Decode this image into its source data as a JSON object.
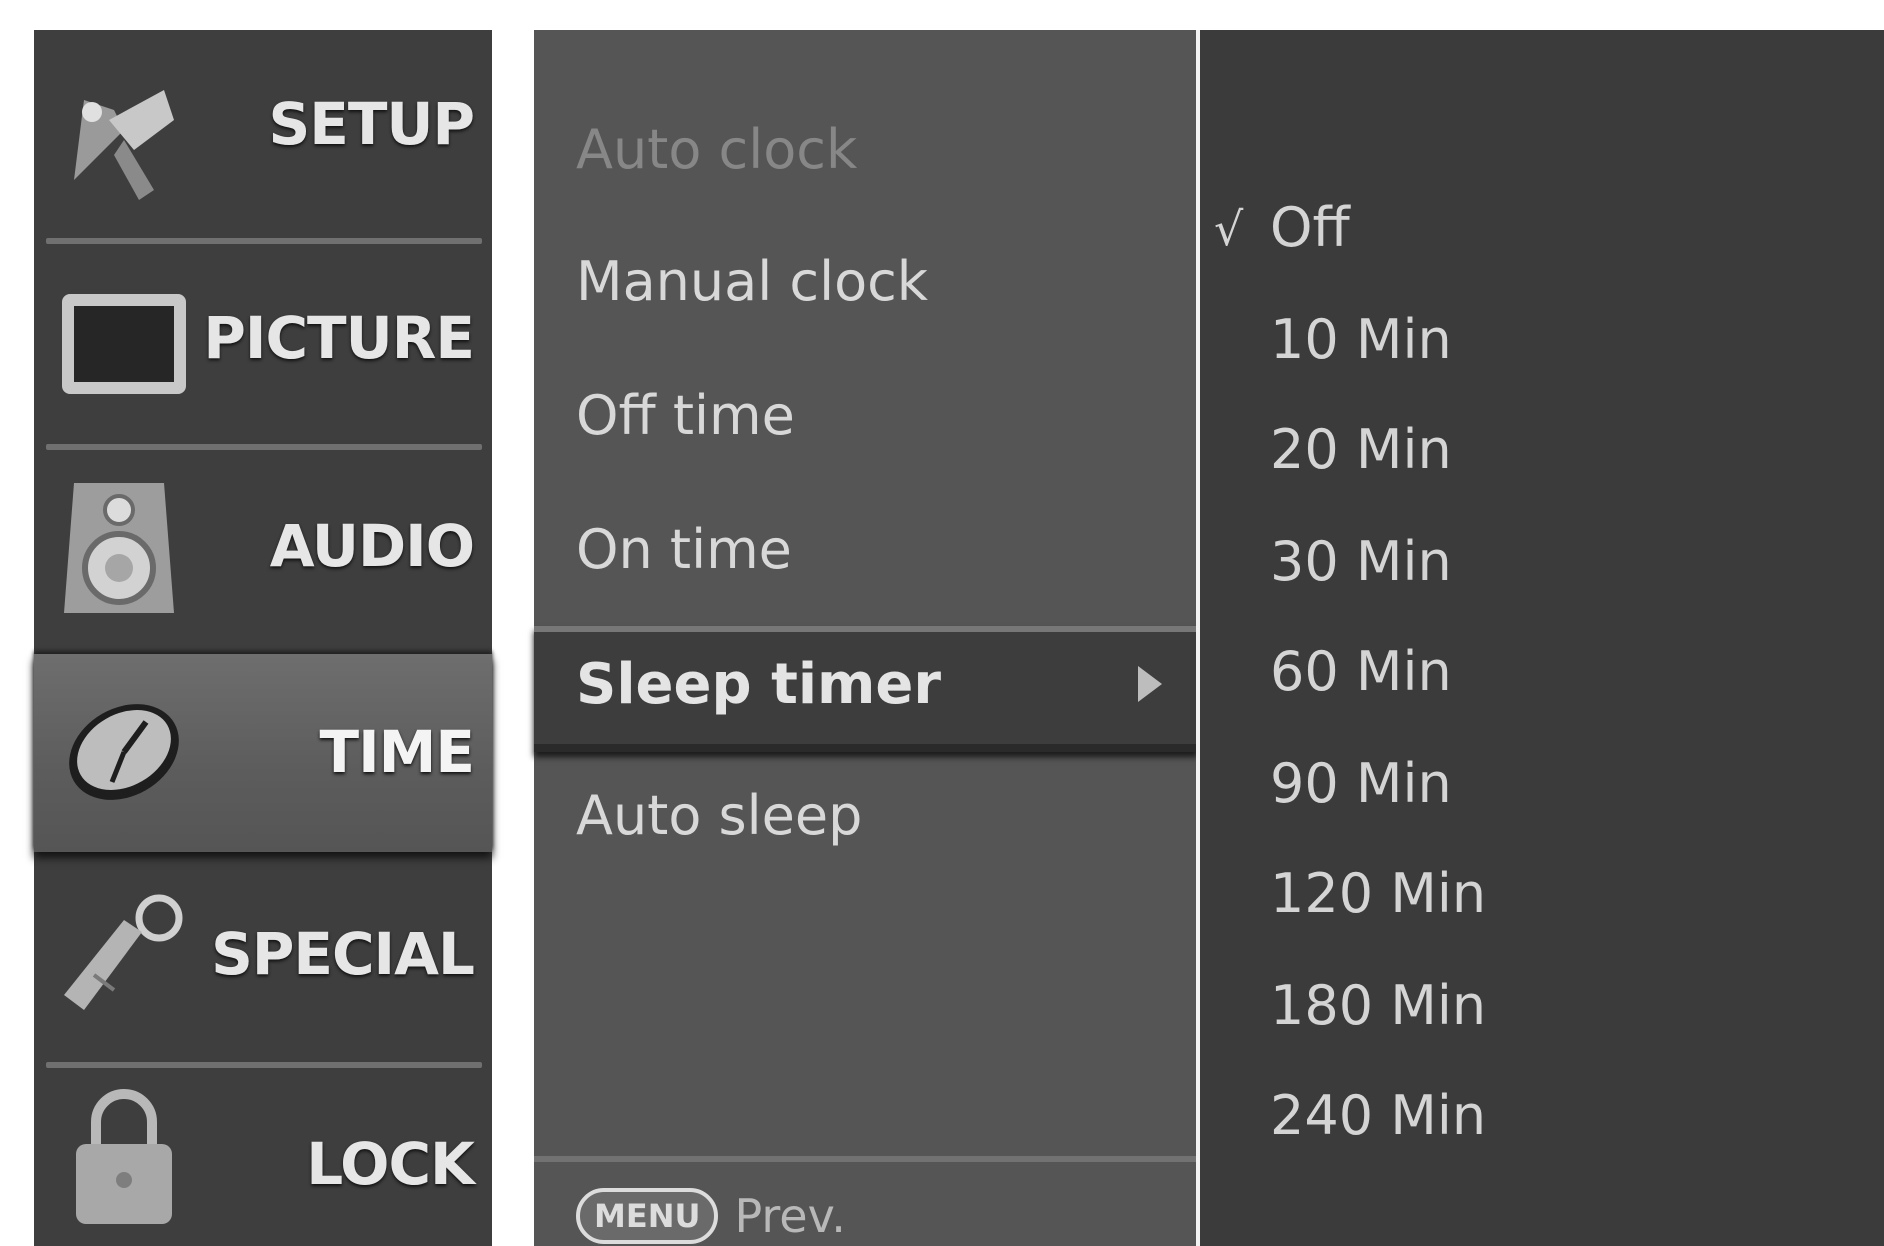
{
  "categories": [
    {
      "label": "SETUP",
      "icon": "satellite-icon",
      "active": false
    },
    {
      "label": "PICTURE",
      "icon": "tv-screen-icon",
      "active": false
    },
    {
      "label": "AUDIO",
      "icon": "speaker-icon",
      "active": false
    },
    {
      "label": "TIME",
      "icon": "clock-icon",
      "active": true
    },
    {
      "label": "SPECIAL",
      "icon": "tag-key-icon",
      "active": false
    },
    {
      "label": "LOCK",
      "icon": "padlock-icon",
      "active": false
    }
  ],
  "options": [
    {
      "label": "Auto clock",
      "disabled": true
    },
    {
      "label": "Manual clock",
      "disabled": false
    },
    {
      "label": "Off time",
      "disabled": false
    },
    {
      "label": "On time",
      "disabled": false
    },
    {
      "label": "Sleep timer",
      "selected": true
    },
    {
      "label": "Auto sleep",
      "disabled": false
    }
  ],
  "footer": {
    "key_label": "MENU",
    "text": "Prev."
  },
  "values": {
    "check_mark": "√",
    "items": [
      "Off",
      "10 Min",
      "20 Min",
      "30 Min",
      "60 Min",
      "90 Min",
      "120 Min",
      "180 Min",
      "240 Min"
    ],
    "selected_index": 0
  },
  "colors": {
    "category_bg": "#3e3e3e",
    "options_bg": "#555555",
    "values_bg": "#3b3b3b",
    "active_highlight": "#5c5c5c"
  }
}
